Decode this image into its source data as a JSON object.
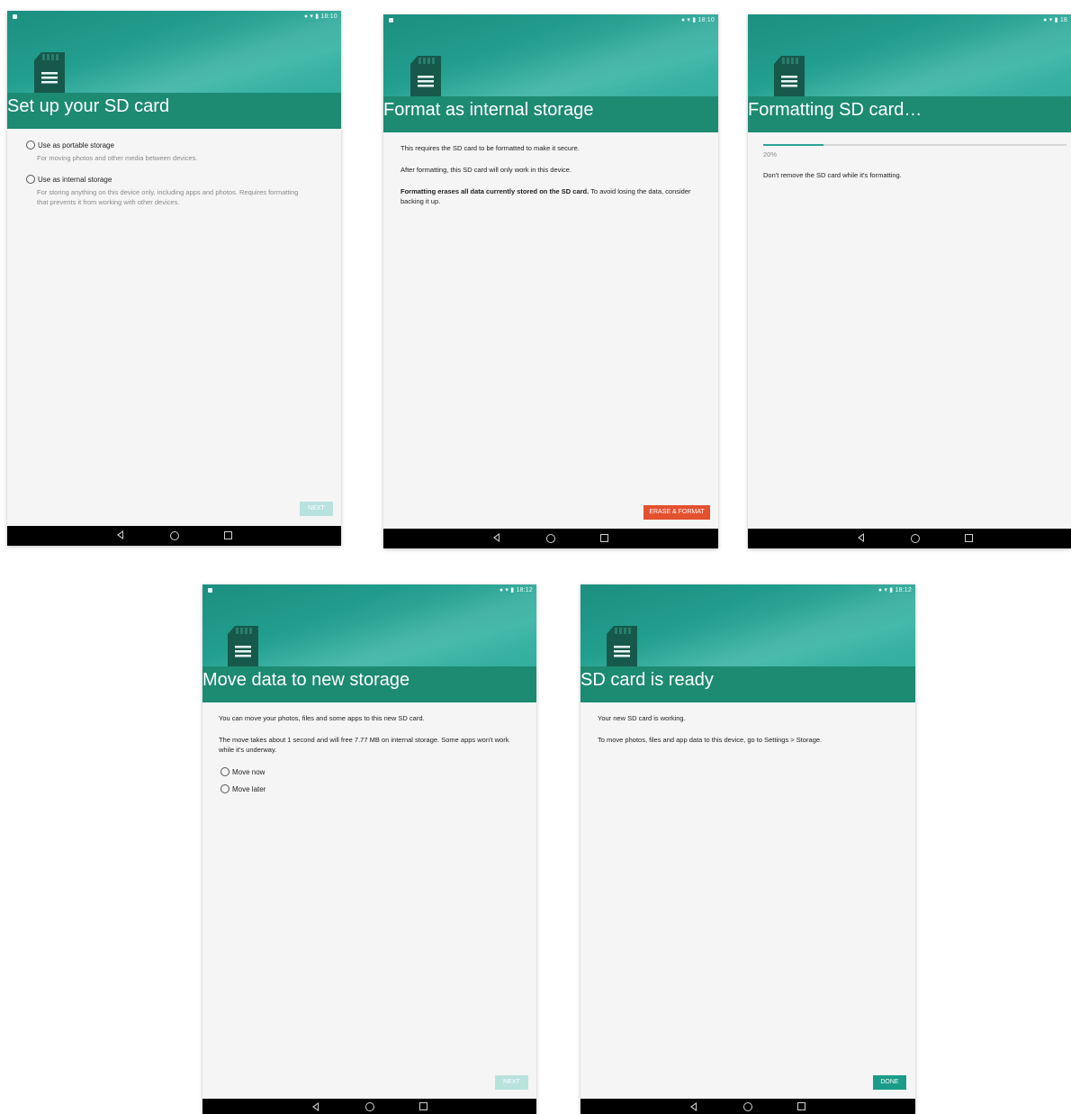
{
  "colors": {
    "accent": "#2aa596",
    "title_bar": "#1d8a72",
    "erase_button": "#e4512f",
    "done_button": "#1a9c88",
    "navbar": "#000000"
  },
  "screens": [
    {
      "status_time": "18:10",
      "title": "Set up your SD card",
      "options": [
        {
          "label": "Use as portable storage",
          "desc": "For moving photos and other media between devices."
        },
        {
          "label": "Use as internal storage",
          "desc": "For storing anything on this device only, including apps and photos. Requires formatting that prevents it from working with other devices."
        }
      ],
      "button": "NEXT"
    },
    {
      "status_time": "18:10",
      "title": "Format as internal storage",
      "p1": "This requires the SD card to be formatted to make it secure.",
      "p2": "After formatting, this SD card will only work in this device.",
      "p3_bold": "Formatting erases all data currently stored on the SD card.",
      "p3_rest": " To avoid losing the data, consider backing it up.",
      "button": "ERASE & FORMAT"
    },
    {
      "status_time": "18",
      "title": "Formatting SD card…",
      "progress": 0.2,
      "progress_label": "20%",
      "p1": "Don't remove the SD card while it's formatting."
    },
    {
      "status_time": "18:12",
      "title": "Move data to new storage",
      "p1": "You can move your photos, files and some apps to this new SD card.",
      "p2": "The move takes about 1 second and will free 7.77 MB on internal storage. Some apps won't work while it's underway.",
      "options": [
        {
          "label": "Move now"
        },
        {
          "label": "Move later"
        }
      ],
      "button": "NEXT"
    },
    {
      "status_time": "18:12",
      "title": "SD card is ready",
      "p1": "Your new SD card is working.",
      "p2": "To move photos, files and app data to this device, go to Settings > Storage.",
      "button": "DONE"
    }
  ]
}
